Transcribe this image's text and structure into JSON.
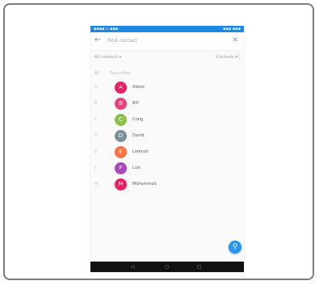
{
  "status_bar": {
    "left": "▪▪▪▪ ▫ ▪▪▪",
    "right": "▪▪▪ ▪▪▪"
  },
  "toolbar": {
    "title": "Find contact"
  },
  "filter": {
    "left_label": "All contacts ▾",
    "right_label": "Contacts ▾"
  },
  "section": {
    "letter": "All",
    "label": "Favourites"
  },
  "contacts": [
    {
      "index": "A",
      "initial": "A",
      "name": "Alexis",
      "color": "#e91e63"
    },
    {
      "index": "B",
      "initial": "B",
      "name": "Bill",
      "color": "#ec407a"
    },
    {
      "index": "C",
      "initial": "C",
      "name": "Craig",
      "color": "#8bc34a"
    },
    {
      "index": "D",
      "initial": "D",
      "name": "David",
      "color": "#78909c"
    },
    {
      "index": "E",
      "initial": "E",
      "name": "Lorenzo",
      "color": "#ff7043"
    },
    {
      "index": "F",
      "initial": "F",
      "name": "Luis",
      "color": "#ab47bc"
    },
    {
      "index": "M",
      "initial": "M",
      "name": "Mohammed",
      "color": "#e91e63"
    }
  ],
  "icons": {
    "back": "back-arrow-icon",
    "close": "close-icon",
    "more": "more-vert-icon",
    "fab": "search-icon",
    "nav": [
      "back-icon",
      "home-icon",
      "recents-icon"
    ]
  },
  "colors": {
    "status_bar": "#1e88e5",
    "fab": "#2196f3",
    "navbar": "#111111"
  }
}
